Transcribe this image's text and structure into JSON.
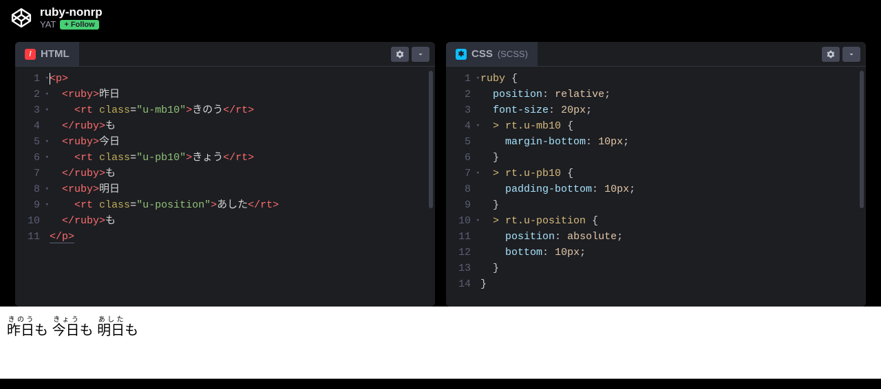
{
  "header": {
    "title": "ruby-nonrp",
    "author": "YAT",
    "follow": "+ Follow"
  },
  "panels": {
    "html": {
      "label": "HTML",
      "lines": [
        {
          "n": 1,
          "fold": true,
          "html": "<span class='cursor'></span><span class='tag'>&lt;p&gt;</span>"
        },
        {
          "n": 2,
          "fold": true,
          "html": "  <span class='tag'>&lt;ruby&gt;</span><span class='txt'>昨日</span>"
        },
        {
          "n": 3,
          "fold": true,
          "html": "    <span class='tag'>&lt;rt</span> <span class='attr'>class</span>=<span class='str'>\"u-mb10\"</span><span class='tag'>&gt;</span><span class='txt'>きのう</span><span class='tag'>&lt;/rt&gt;</span>"
        },
        {
          "n": 4,
          "fold": false,
          "html": "  <span class='tag'>&lt;/ruby&gt;</span><span class='txt'>も</span>"
        },
        {
          "n": 5,
          "fold": true,
          "html": "  <span class='tag'>&lt;ruby&gt;</span><span class='txt'>今日</span>"
        },
        {
          "n": 6,
          "fold": true,
          "html": "    <span class='tag'>&lt;rt</span> <span class='attr'>class</span>=<span class='str'>\"u-pb10\"</span><span class='tag'>&gt;</span><span class='txt'>きょう</span><span class='tag'>&lt;/rt&gt;</span>"
        },
        {
          "n": 7,
          "fold": false,
          "html": "  <span class='tag'>&lt;/ruby&gt;</span><span class='txt'>も</span>"
        },
        {
          "n": 8,
          "fold": true,
          "html": "  <span class='tag'>&lt;ruby&gt;</span><span class='txt'>明日</span>"
        },
        {
          "n": 9,
          "fold": true,
          "html": "    <span class='tag'>&lt;rt</span> <span class='attr'>class</span>=<span class='str'>\"u-position\"</span><span class='tag'>&gt;</span><span class='txt'>あした</span><span class='tag'>&lt;/rt&gt;</span>"
        },
        {
          "n": 10,
          "fold": false,
          "html": "  <span class='tag'>&lt;/ruby&gt;</span><span class='txt'>も</span>"
        },
        {
          "n": 11,
          "fold": false,
          "html": "<span class='tag underline-close'>&lt;/p&gt;</span>"
        }
      ]
    },
    "css": {
      "label": "CSS",
      "sublabel": "(SCSS)",
      "lines": [
        {
          "n": 1,
          "fold": true,
          "html": "<span class='sel'>ruby</span> <span class='brace'>{</span>"
        },
        {
          "n": 2,
          "fold": false,
          "html": "  <span class='prop'>position</span><span class='punct'>:</span> <span class='val'>relative</span><span class='punct'>;</span>"
        },
        {
          "n": 3,
          "fold": false,
          "html": "  <span class='prop'>font-size</span><span class='punct'>:</span> <span class='val'>20px</span><span class='punct'>;</span>"
        },
        {
          "n": 4,
          "fold": true,
          "html": "  <span class='sel'>&gt; rt.u-mb10</span> <span class='brace'>{</span>"
        },
        {
          "n": 5,
          "fold": false,
          "html": "    <span class='prop'>margin-bottom</span><span class='punct'>:</span> <span class='val'>10px</span><span class='punct'>;</span>"
        },
        {
          "n": 6,
          "fold": false,
          "html": "  <span class='brace'>}</span>"
        },
        {
          "n": 7,
          "fold": true,
          "html": "  <span class='sel'>&gt; rt.u-pb10</span> <span class='brace'>{</span>"
        },
        {
          "n": 8,
          "fold": false,
          "html": "    <span class='prop'>padding-bottom</span><span class='punct'>:</span> <span class='val'>10px</span><span class='punct'>;</span>"
        },
        {
          "n": 9,
          "fold": false,
          "html": "  <span class='brace'>}</span>"
        },
        {
          "n": 10,
          "fold": true,
          "html": "  <span class='sel'>&gt; rt.u-position</span> <span class='brace'>{</span>"
        },
        {
          "n": 11,
          "fold": false,
          "html": "    <span class='prop'>position</span><span class='punct'>:</span> <span class='val'>absolute</span><span class='punct'>;</span>"
        },
        {
          "n": 12,
          "fold": false,
          "html": "    <span class='prop'>bottom</span><span class='punct'>:</span> <span class='val'>10px</span><span class='punct'>;</span>"
        },
        {
          "n": 13,
          "fold": false,
          "html": "  <span class='brace'>}</span>"
        },
        {
          "n": 14,
          "fold": false,
          "html": "<span class='brace'>}</span>"
        }
      ]
    }
  },
  "output": {
    "items": [
      {
        "base": "昨日",
        "rt": "きのう"
      },
      {
        "base": "今日",
        "rt": "きょう"
      },
      {
        "base": "明日",
        "rt": "あした"
      }
    ],
    "sep": "も"
  }
}
